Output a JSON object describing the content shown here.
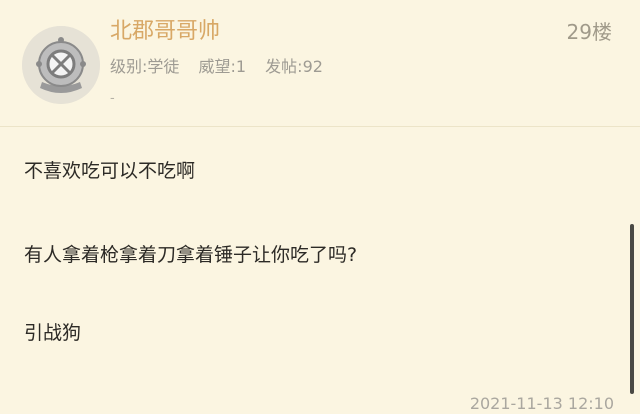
{
  "post": {
    "username": "北郡哥哥帅",
    "floor": "29楼",
    "meta": {
      "level": "级别:学徒",
      "prestige": "威望:1",
      "posts": "发帖:92"
    },
    "signature": "-",
    "content": [
      "不喜欢吃可以不吃啊",
      "有人拿着枪拿着刀拿着锤子让你吃了吗?",
      "引战狗"
    ],
    "timestamp": "2021-11-13 12:10"
  },
  "colors": {
    "background": "#fbf5e1",
    "username": "#d8a866",
    "text": "#2c2a26",
    "muted": "#9e9b93"
  },
  "icons": {
    "avatar": "diving-helmet-avatar",
    "edit": "pencil-icon"
  }
}
